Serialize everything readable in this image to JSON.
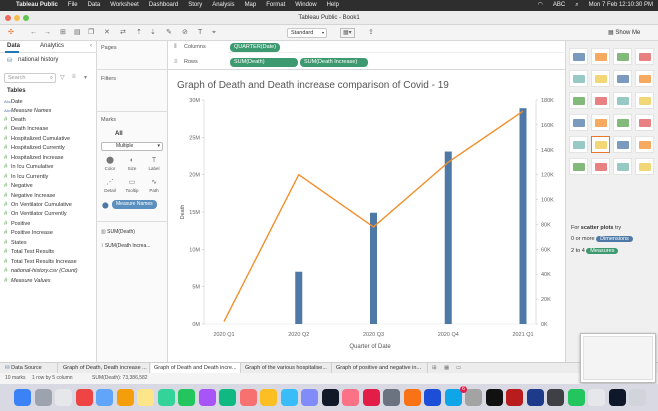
{
  "menubar": {
    "app": "Tableau Public",
    "items": [
      "File",
      "Data",
      "Worksheet",
      "Dashboard",
      "Story",
      "Analysis",
      "Map",
      "Format",
      "Window",
      "Help"
    ],
    "input_source": "ABC",
    "clock": "Mon 7 Feb  12:10:30 PM"
  },
  "window": {
    "title": "Tableau Public - Book1"
  },
  "toolbar": {
    "fit_value": "Standard",
    "show_me_label": "Show Me"
  },
  "data_pane": {
    "tab_data": "Data",
    "tab_analytics": "Analytics",
    "source": "national history",
    "search_placeholder": "Search",
    "tables_header": "Tables",
    "fields": [
      {
        "label": "Date",
        "kind": "dim",
        "italic": false
      },
      {
        "label": "Measure Names",
        "kind": "dim",
        "italic": true
      },
      {
        "label": "Death",
        "kind": "measure",
        "italic": false
      },
      {
        "label": "Death Increase",
        "kind": "measure",
        "italic": false
      },
      {
        "label": "Hospitalized Cumulative",
        "kind": "measure",
        "italic": false
      },
      {
        "label": "Hospitalized Currently",
        "kind": "measure",
        "italic": false
      },
      {
        "label": "Hospitalized Increase",
        "kind": "measure",
        "italic": false
      },
      {
        "label": "In Icu Cumulative",
        "kind": "measure",
        "italic": false
      },
      {
        "label": "In Icu Currently",
        "kind": "measure",
        "italic": false
      },
      {
        "label": "Negative",
        "kind": "measure",
        "italic": false
      },
      {
        "label": "Negative Increase",
        "kind": "measure",
        "italic": false
      },
      {
        "label": "On Ventilator Cumulative",
        "kind": "measure",
        "italic": false
      },
      {
        "label": "On Ventilator Currently",
        "kind": "measure",
        "italic": false
      },
      {
        "label": "Positive",
        "kind": "measure",
        "italic": false
      },
      {
        "label": "Positive Increase",
        "kind": "measure",
        "italic": false
      },
      {
        "label": "States",
        "kind": "measure",
        "italic": false
      },
      {
        "label": "Total Test Results",
        "kind": "measure",
        "italic": false
      },
      {
        "label": "Total Test Results Increase",
        "kind": "measure",
        "italic": false
      },
      {
        "label": "national-history.csv (Count)",
        "kind": "measure",
        "italic": true
      },
      {
        "label": "Measure Values",
        "kind": "measure",
        "italic": true
      }
    ]
  },
  "cards": {
    "pages": "Pages",
    "filters": "Filters",
    "marks": "Marks",
    "all_label": "All",
    "mark_type": "Multiple",
    "buttons": [
      "Color",
      "Size",
      "Label",
      "Detail",
      "Tooltip",
      "Path"
    ],
    "measure_names_pill": "Measure Names",
    "sub_marks": [
      "SUM(Death)",
      "SUM(Death Increa..."
    ]
  },
  "shelves": {
    "columns_label": "Columns",
    "rows_label": "Rows",
    "columns_pill": "QUARTER(Date)",
    "rows_pills": [
      "SUM(Death)",
      "SUM(Death Increase)"
    ]
  },
  "chart_data": {
    "type": "bar",
    "title": "Graph of Death and Death increase comparison of Covid - 19",
    "xlabel": "Quarter of Date",
    "ylabel": "Death",
    "categories": [
      "2020 Q1",
      "2020 Q2",
      "2020 Q3",
      "2020 Q4",
      "2021 Q1"
    ],
    "series": [
      {
        "name": "SUM(Death)",
        "chart": "bar",
        "axis": "left",
        "color": "#4e79a7",
        "values": [
          0,
          7000000,
          14900000,
          23100000,
          28900000
        ]
      },
      {
        "name": "SUM(Death Increase)",
        "chart": "line",
        "axis": "right",
        "color": "#f28e2b",
        "values": [
          2000,
          120000,
          78000,
          130000,
          171000
        ]
      }
    ],
    "ylim_left": [
      0,
      30000000
    ],
    "yticks_left": [
      "0M",
      "5M",
      "10M",
      "15M",
      "20M",
      "25M",
      "30M"
    ],
    "ylim_right": [
      0,
      180000
    ],
    "yticks_right": [
      "0K",
      "20K",
      "40K",
      "60K",
      "80K",
      "100K",
      "120K",
      "140K",
      "160K",
      "180K"
    ],
    "grid": false
  },
  "show_me": {
    "hint_prefix": "For ",
    "hint_bold": "scatter plots",
    "hint_suffix": " try",
    "line1_prefix": "0 or more",
    "line1_pill": "Dimensions",
    "line2_prefix": "2 to 4",
    "line2_pill": "Measures"
  },
  "sheet_tabs": {
    "data_source": "Data Source",
    "tabs": [
      "Graph of Death, Death increase ...",
      "Graph of Death and Death incre...",
      "Graph of the various hospitalise...",
      "Graph of positive and negative in..."
    ],
    "active_index": 1
  },
  "status": {
    "marks": "10 marks",
    "rows_cols": "1 row by 5 column",
    "sum": "SUM(Death): 73,386,582"
  },
  "dock": {
    "badge_count": "6"
  }
}
